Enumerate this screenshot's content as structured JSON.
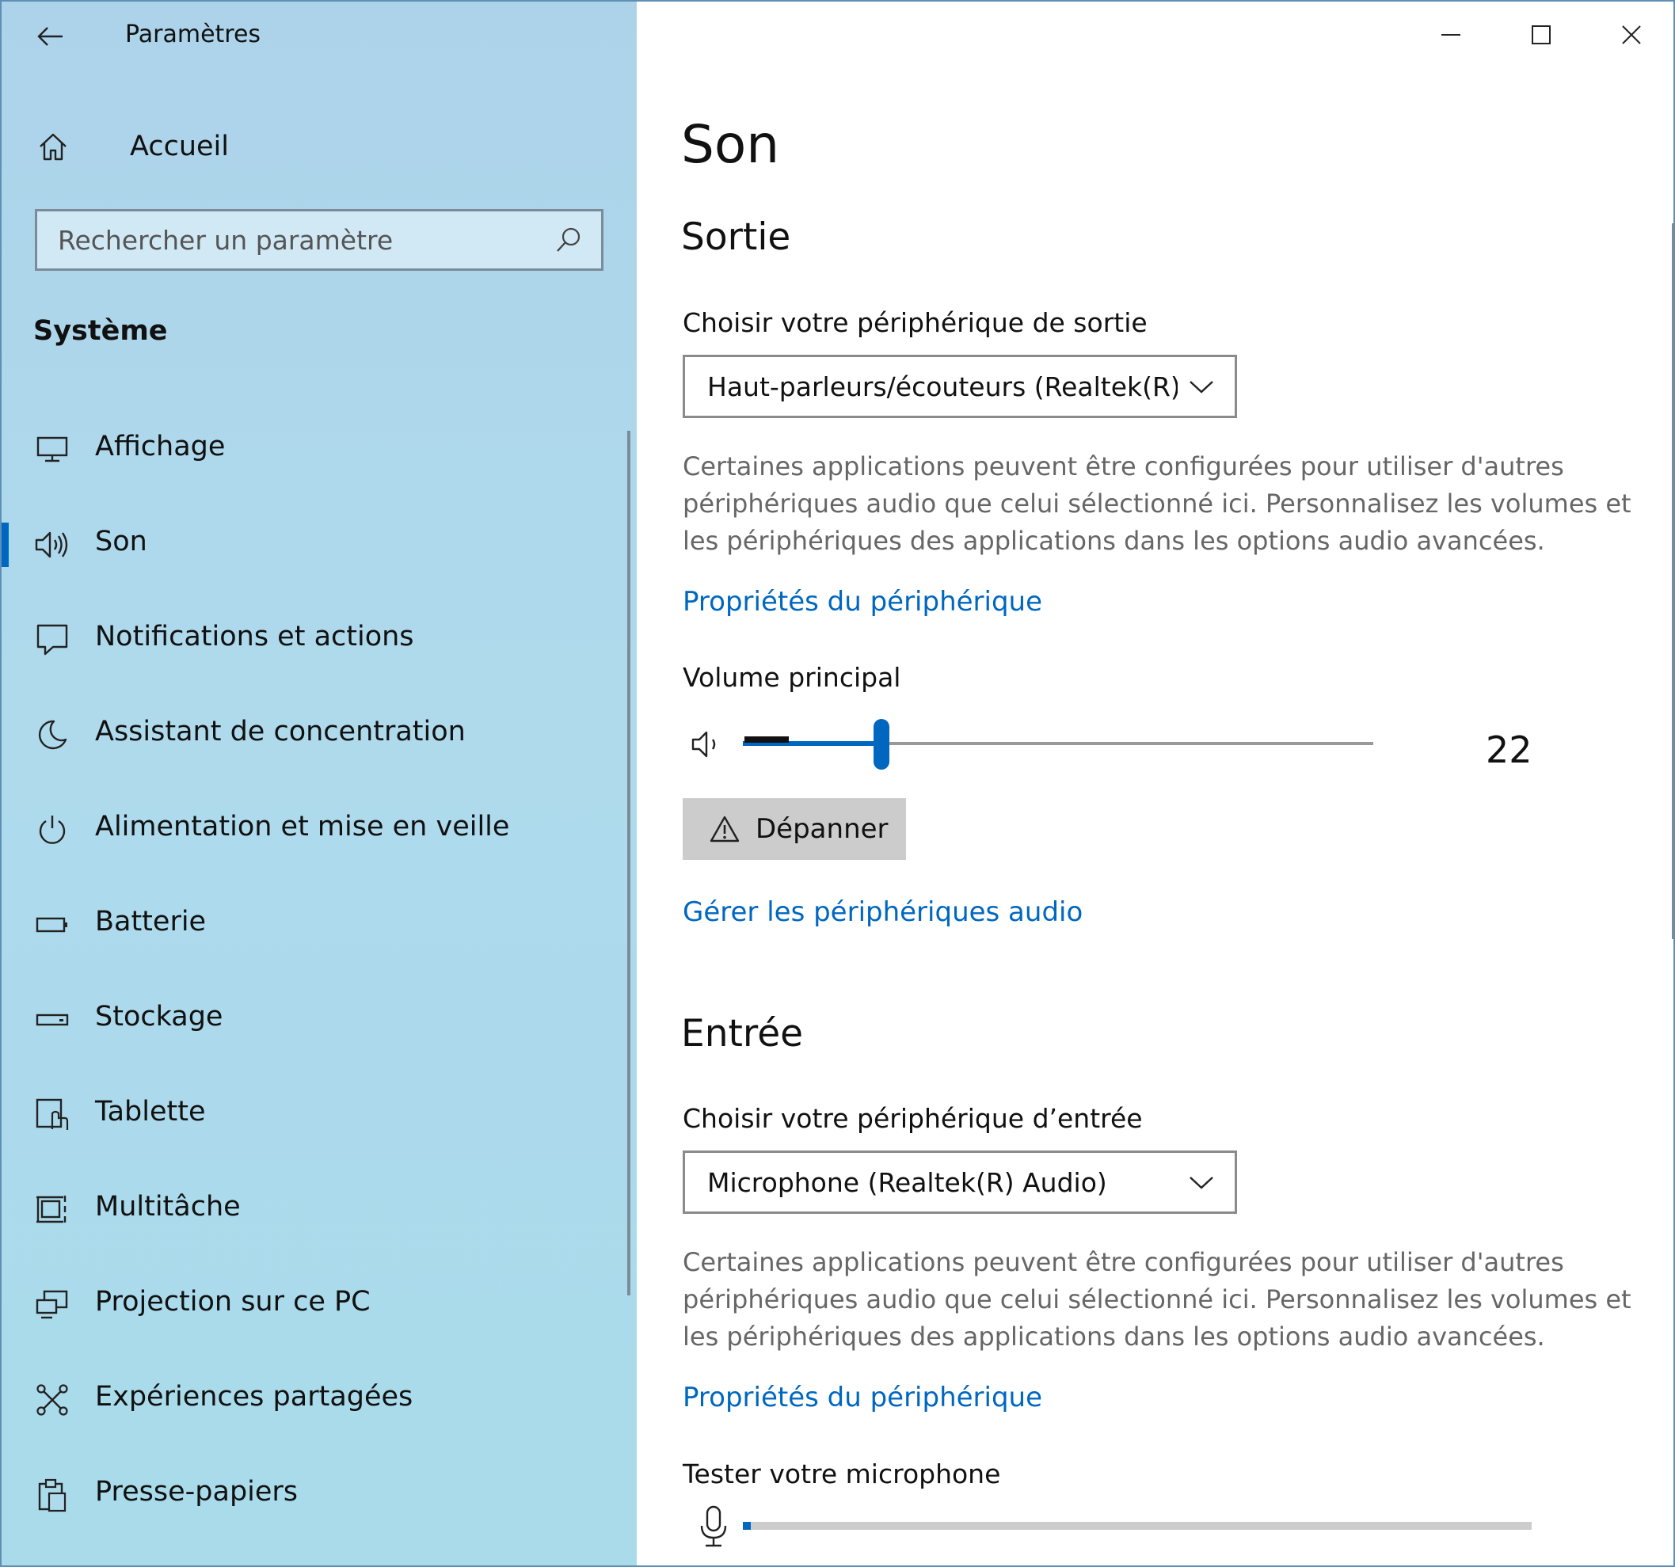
{
  "app": {
    "title": "Paramètres"
  },
  "sidebar": {
    "home_label": "Accueil",
    "search": {
      "placeholder": "Rechercher un paramètre",
      "value": ""
    },
    "section_title": "Système",
    "items": [
      {
        "label": "Affichage",
        "icon": "monitor-icon",
        "selected": false
      },
      {
        "label": "Son",
        "icon": "speaker-icon",
        "selected": true
      },
      {
        "label": "Notifications et actions",
        "icon": "notification-icon",
        "selected": false
      },
      {
        "label": "Assistant de concentration",
        "icon": "moon-icon",
        "selected": false
      },
      {
        "label": "Alimentation et mise en veille",
        "icon": "power-icon",
        "selected": false
      },
      {
        "label": "Batterie",
        "icon": "battery-icon",
        "selected": false
      },
      {
        "label": "Stockage",
        "icon": "storage-icon",
        "selected": false
      },
      {
        "label": "Tablette",
        "icon": "tablet-icon",
        "selected": false
      },
      {
        "label": "Multitâche",
        "icon": "multitask-icon",
        "selected": false
      },
      {
        "label": "Projection sur ce PC",
        "icon": "projection-icon",
        "selected": false
      },
      {
        "label": "Expériences partagées",
        "icon": "shared-experiences-icon",
        "selected": false
      },
      {
        "label": "Presse-papiers",
        "icon": "clipboard-icon",
        "selected": false
      }
    ]
  },
  "main": {
    "page_title": "Son",
    "output": {
      "heading": "Sortie",
      "choose_label": "Choisir votre périphérique de sortie",
      "device": "Haut-parleurs/écouteurs (Realtek(R)...",
      "description": "Certaines applications peuvent être configurées pour utiliser d'autres périphériques audio que celui sélectionné ici. Personnalisez les volumes et les périphériques des applications dans les options audio avancées.",
      "properties_link": "Propriétés du périphérique",
      "volume_label": "Volume principal",
      "volume_value": "22",
      "volume_percent": 22,
      "troubleshoot_label": "Dépanner",
      "manage_link": "Gérer les périphériques audio"
    },
    "input": {
      "heading": "Entrée",
      "choose_label": "Choisir votre périphérique d’entrée",
      "device": "Microphone (Realtek(R) Audio)",
      "description": "Certaines applications peuvent être configurées pour utiliser d'autres périphériques audio que celui sélectionné ici. Personnalisez les volumes et les périphériques des applications dans les options audio avancées.",
      "properties_link": "Propriétés du périphérique",
      "test_label": "Tester votre microphone",
      "mic_level_percent": 1
    }
  },
  "colors": {
    "accent": "#0067c0",
    "sidebar_bg": "#aed8ec",
    "link": "#0067c0",
    "description_text": "#666666"
  }
}
